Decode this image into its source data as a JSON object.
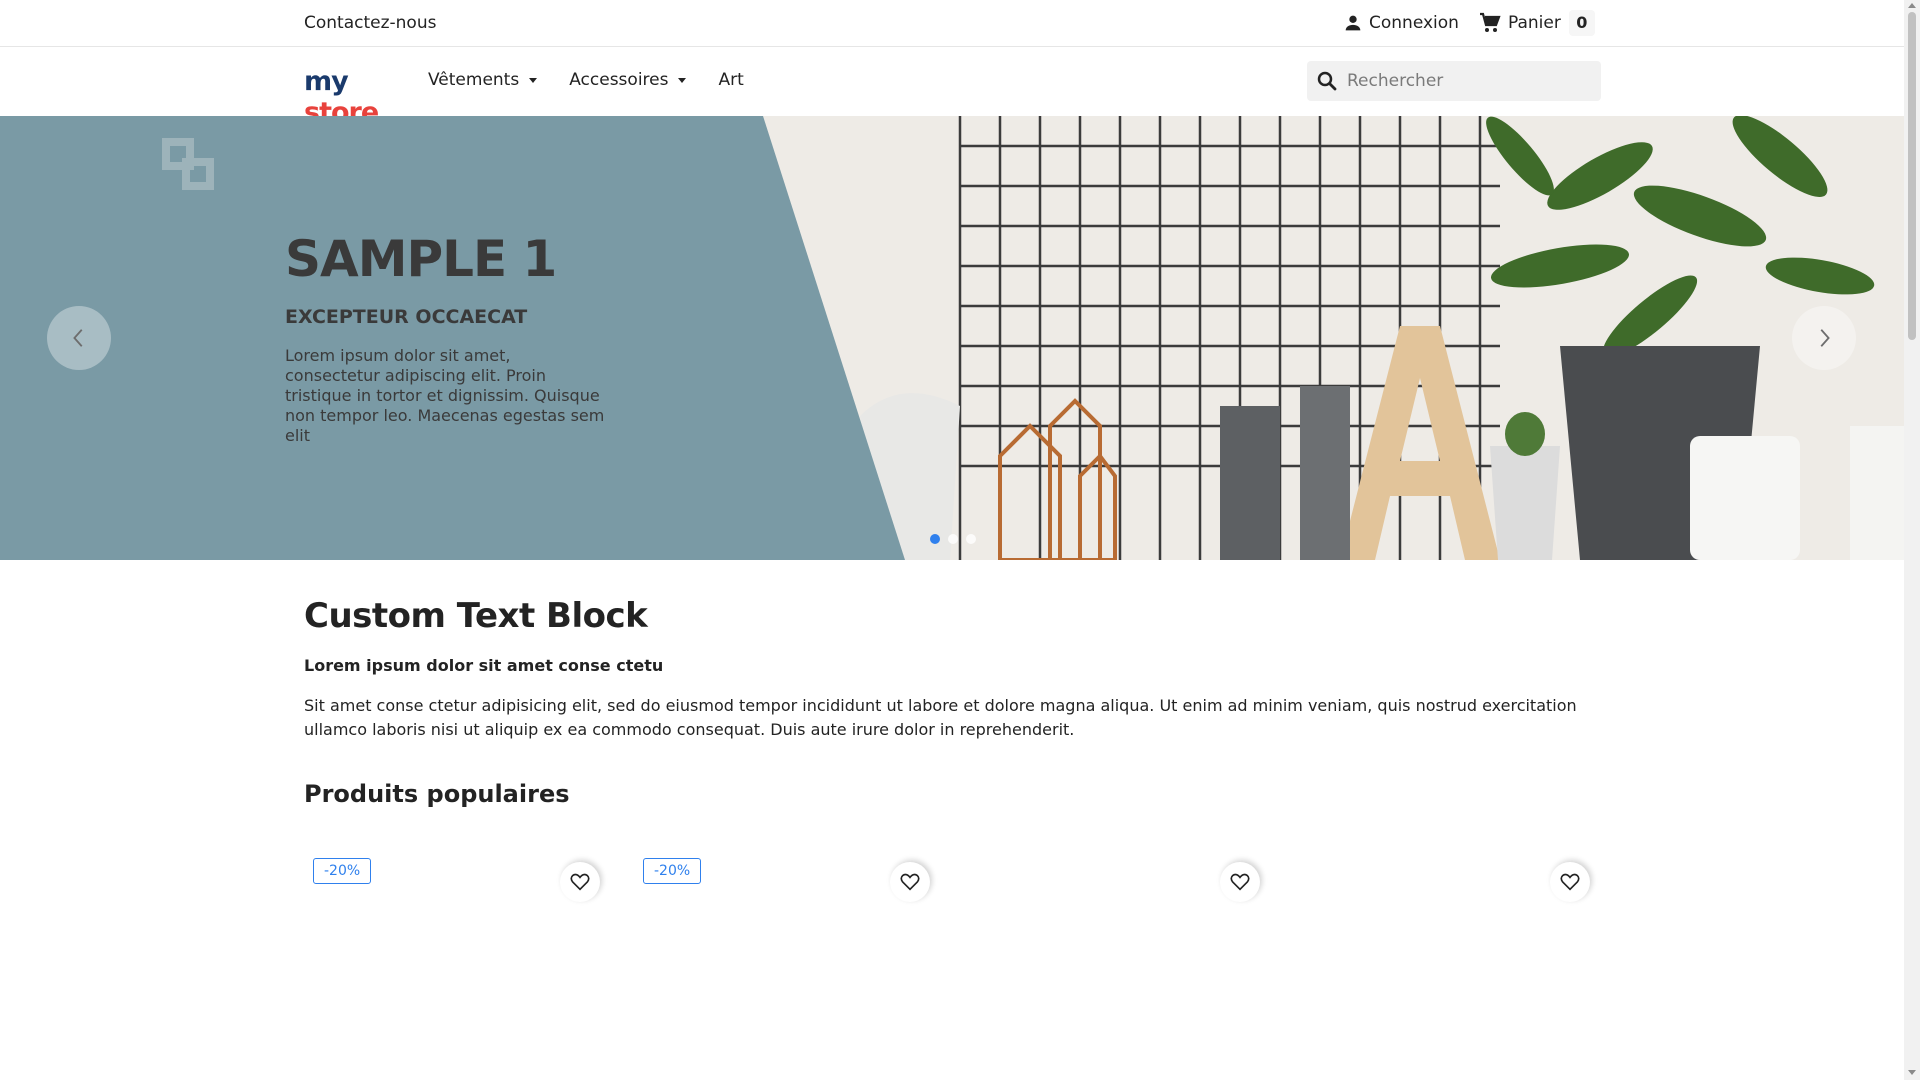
{
  "topbar": {
    "contact_label": "Contactez-nous",
    "account_label": "Connexion",
    "cart_label": "Panier",
    "cart_count": "0"
  },
  "header": {
    "logo": {
      "part1": "my",
      "part2": "store"
    },
    "nav": [
      {
        "label": "Vêtements"
      },
      {
        "label": "Accessoires"
      },
      {
        "label": "Art"
      }
    ],
    "search": {
      "placeholder": "Rechercher"
    }
  },
  "hero": {
    "title": "SAMPLE 1",
    "subtitle": "EXCEPTEUR OCCAECAT",
    "description": "Lorem ipsum dolor sit amet, consectetur adipiscing elit. Proin tristique in tortor et dignissim. Quisque non tempor leo. Maecenas egestas sem elit",
    "slide_count": 3,
    "active_slide": 1,
    "panel_color": "#7a9aa5",
    "active_dot_color": "#2f80ed"
  },
  "content": {
    "title": "Custom Text Block",
    "strong": "Lorem ipsum dolor sit amet conse ctetu",
    "text": "Sit amet conse ctetur adipisicing elit, sed do eiusmod tempor incididunt ut labore et dolore magna aliqua. Ut enim ad minim veniam, quis nostrud exercitation ullamco laboris nisi ut aliquip ex ea commodo consequat. Duis aute irure dolor in reprehenderit."
  },
  "products": {
    "section_title": "Produits populaires",
    "items": [
      {
        "badge": "-20%"
      },
      {
        "badge": "-20%"
      },
      {
        "badge": ""
      },
      {
        "badge": ""
      }
    ]
  },
  "icons": {
    "account": "person-icon",
    "cart": "shopping-cart-icon",
    "search": "search-icon",
    "prev": "chevron-left-icon",
    "next": "chevron-right-icon",
    "wishlist": "heart-icon"
  }
}
